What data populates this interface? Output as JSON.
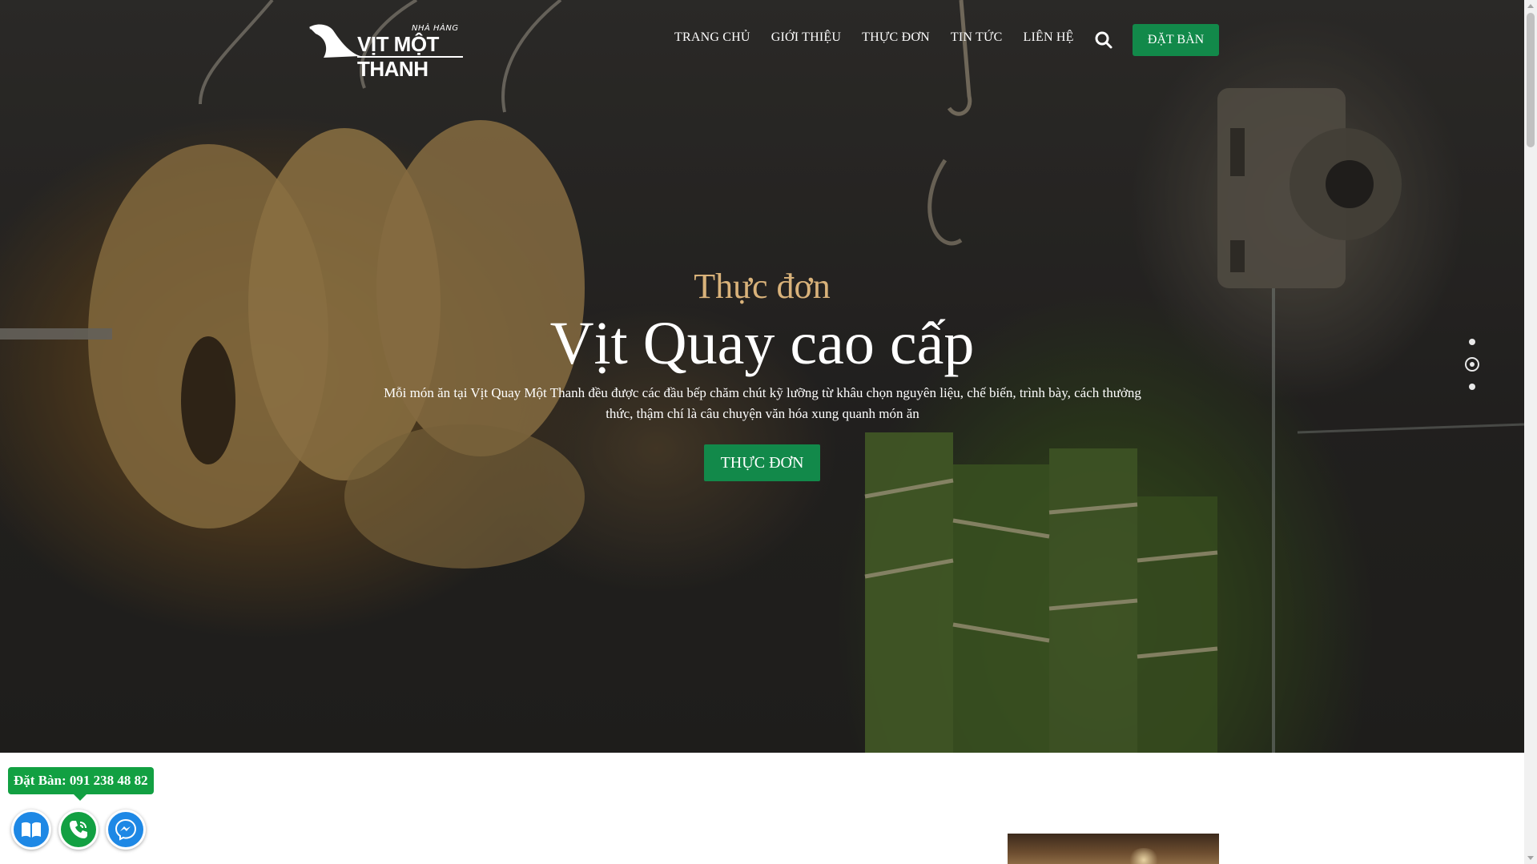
{
  "brand": {
    "small_text": "NHÀ HÀNG",
    "name": "VỊT MỘT THANH"
  },
  "nav": {
    "items": [
      "TRANG CHỦ",
      "GIỚI THIỆU",
      "THỰC ĐƠN",
      "TIN TỨC",
      "LIÊN HỆ"
    ],
    "search_icon": "search-icon",
    "book_label": "ĐẶT BÀN"
  },
  "hero": {
    "subtitle": "Thực đơn",
    "title": "Vịt Quay cao cấp",
    "description": "Mỗi món ăn tại Vịt Quay Một Thanh đều được các đầu bếp chăm chút kỹ lưỡng từ khâu chọn nguyên liệu, chế biến, trình bày, cách thưởng thức, thậm chí là câu chuyện văn hóa xung quanh món ăn",
    "cta_label": "THỰC ĐƠN",
    "slides": {
      "count": 3,
      "active_index": 1
    }
  },
  "contact": {
    "phone_label": "Đặt Bàn: 091 238 48 82",
    "buttons": [
      {
        "name": "menu-book-icon",
        "color": "#1e88e5"
      },
      {
        "name": "phone-icon",
        "color": "#12a042"
      },
      {
        "name": "messenger-icon",
        "color": "#1e88e5"
      }
    ]
  },
  "colors": {
    "accent_green": "#12894a",
    "subtitle_gold": "#d9b27a"
  }
}
